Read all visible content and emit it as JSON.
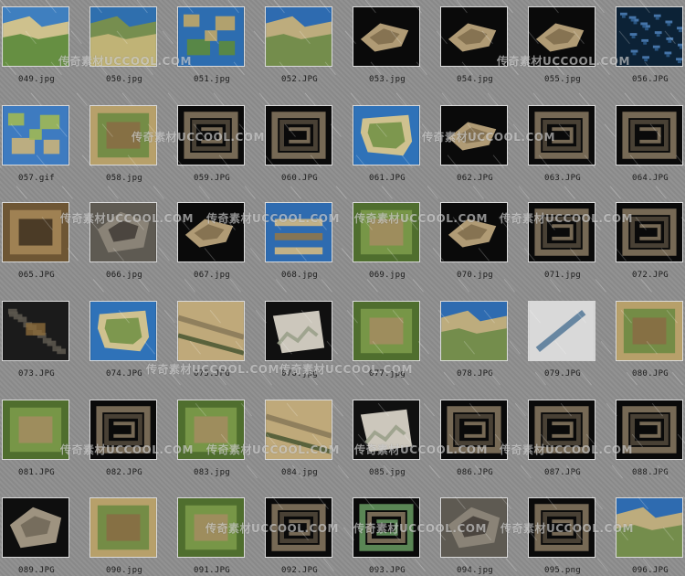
{
  "watermark": "传奇素材UCCOOL.COM",
  "thumbnails": [
    {
      "label": "049.jpg",
      "style": "coast"
    },
    {
      "label": "050.jpg",
      "style": "coast2"
    },
    {
      "label": "051.jpg",
      "style": "islands"
    },
    {
      "label": "052.JPG",
      "style": "coast3"
    },
    {
      "label": "053.jpg",
      "style": "darkland"
    },
    {
      "label": "054.jpg",
      "style": "darkland"
    },
    {
      "label": "055.jpg",
      "style": "darkland"
    },
    {
      "label": "056.JPG",
      "style": "waterblue"
    },
    {
      "label": "057.gif",
      "style": "islandsbig"
    },
    {
      "label": "058.jpg",
      "style": "desert"
    },
    {
      "label": "059.JPG",
      "style": "maze"
    },
    {
      "label": "060.JPG",
      "style": "maze"
    },
    {
      "label": "061.JPG",
      "style": "island"
    },
    {
      "label": "062.JPG",
      "style": "darkland"
    },
    {
      "label": "063.JPG",
      "style": "maze"
    },
    {
      "label": "064.JPG",
      "style": "maze"
    },
    {
      "label": "065.JPG",
      "style": "brownland"
    },
    {
      "label": "066.jpg",
      "style": "gray"
    },
    {
      "label": "067.jpg",
      "style": "darkland"
    },
    {
      "label": "068.jpg",
      "style": "waterstrips"
    },
    {
      "label": "069.jpg",
      "style": "green"
    },
    {
      "label": "070.jpg",
      "style": "darkland"
    },
    {
      "label": "071.jpg",
      "style": "maze"
    },
    {
      "label": "072.JPG",
      "style": "maze"
    },
    {
      "label": "073.JPG",
      "style": "caves"
    },
    {
      "label": "074.JPG",
      "style": "island"
    },
    {
      "label": "075.JPG",
      "style": "sandroad"
    },
    {
      "label": "076.jpg",
      "style": "whiteland"
    },
    {
      "label": "077.jpg",
      "style": "green"
    },
    {
      "label": "078.JPG",
      "style": "coast3"
    },
    {
      "label": "079.JPG",
      "style": "snow"
    },
    {
      "label": "080.JPG",
      "style": "desert"
    },
    {
      "label": "081.JPG",
      "style": "green"
    },
    {
      "label": "082.JPG",
      "style": "maze"
    },
    {
      "label": "083.jpg",
      "style": "green"
    },
    {
      "label": "084.jpg",
      "style": "sandroad"
    },
    {
      "label": "085.jpg",
      "style": "whiteland"
    },
    {
      "label": "086.JPG",
      "style": "maze"
    },
    {
      "label": "087.JPG",
      "style": "maze"
    },
    {
      "label": "088.JPG",
      "style": "maze"
    },
    {
      "label": "089.JPG",
      "style": "grayland"
    },
    {
      "label": "090.jpg",
      "style": "desert"
    },
    {
      "label": "091.JPG",
      "style": "green"
    },
    {
      "label": "092.JPG",
      "style": "maze"
    },
    {
      "label": "093.JPG",
      "style": "greenmaze"
    },
    {
      "label": "094.jpg",
      "style": "gray"
    },
    {
      "label": "095.png",
      "style": "maze"
    },
    {
      "label": "096.JPG",
      "style": "coast3"
    }
  ],
  "colors": {
    "coast": [
      "#3f7fbf",
      "#d6c58a",
      "#5b8a3a"
    ],
    "coast2": [
      "#2f6fae",
      "#7a8f4a",
      "#c9b77a"
    ],
    "islands": [
      "#2d6db0",
      "#b8a46a",
      "#5d8a3c"
    ],
    "coast3": [
      "#2e6bb0",
      "#c5b07a",
      "#6c8a47"
    ],
    "darkland": [
      "#0a0a0a",
      "#b9a37b",
      "#7f6c4c"
    ],
    "waterblue": [
      "#0c2236",
      "#4b7db5",
      "#2b5a88"
    ],
    "islandsbig": [
      "#3e7bc0",
      "#9bb55a",
      "#c9b27a"
    ],
    "desert": [
      "#b7a06a",
      "#6d8a43",
      "#8a6b44"
    ],
    "maze": [
      "#0a0a0a",
      "#7c6f5a",
      "#4d4538"
    ],
    "island": [
      "#2f72b8",
      "#d8c58c",
      "#6f8f43"
    ],
    "brownland": [
      "#6e5634",
      "#a48656",
      "#3c2f1f"
    ],
    "gray": [
      "#5e5a52",
      "#8c8679",
      "#3f3b35"
    ],
    "waterstrips": [
      "#2e6bb0",
      "#c9b585",
      "#8a7650"
    ],
    "green": [
      "#4f6e2e",
      "#7b9a4a",
      "#a58c62"
    ],
    "caves": [
      "#1b1b1b",
      "#5a554c",
      "#8b6a3a"
    ],
    "sandroad": [
      "#8a7a5a",
      "#bfa97a",
      "#4e5a35"
    ],
    "whiteland": [
      "#101010",
      "#d7d2c6",
      "#9aa08a"
    ],
    "snow": [
      "#d9d9d9",
      "#5a7c9a",
      "#7d8f6a"
    ],
    "grayland": [
      "#0e0e0e",
      "#a79b87",
      "#6f6657"
    ],
    "greenmaze": [
      "#0a0a0a",
      "#5f8d5a",
      "#7c6f5a"
    ]
  }
}
